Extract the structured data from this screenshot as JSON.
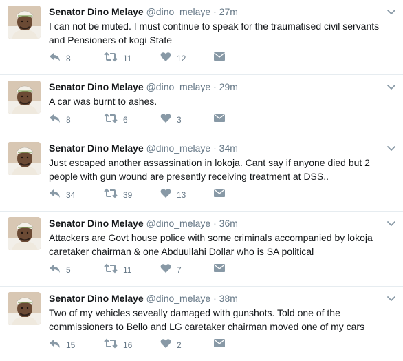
{
  "colors": {
    "icon": "#8899a6",
    "name": "#14171a",
    "meta": "#657786",
    "divider": "#e6ecf0"
  },
  "tweets": [
    {
      "name": "Senator Dino Melaye",
      "handle": "@dino_melaye",
      "separator": "·",
      "time": "27m",
      "text": "I can not be muted. I must continue to speak for the traumatised civil servants and Pensioners of kogi State",
      "replies": "8",
      "retweets": "11",
      "likes": "12"
    },
    {
      "name": "Senator Dino Melaye",
      "handle": "@dino_melaye",
      "separator": "·",
      "time": "29m",
      "text": "A car was burnt to ashes.",
      "replies": "8",
      "retweets": "6",
      "likes": "3"
    },
    {
      "name": "Senator Dino Melaye",
      "handle": "@dino_melaye",
      "separator": "·",
      "time": "34m",
      "text": "Just escaped another assassination in lokoja. Cant say if anyone died but 2 people with gun wound are presently receiving treatment at DSS..",
      "replies": "34",
      "retweets": "39",
      "likes": "13"
    },
    {
      "name": "Senator Dino Melaye",
      "handle": "@dino_melaye",
      "separator": "·",
      "time": "36m",
      "text": "Attackers are Govt house police with some criminals accompanied by lokoja caretaker chairman & one Abduullahi Dollar who is SA political",
      "replies": "5",
      "retweets": "11",
      "likes": "7"
    },
    {
      "name": "Senator Dino Melaye",
      "handle": "@dino_melaye",
      "separator": "·",
      "time": "38m",
      "text": "Two of my vehicles seveally damaged with gunshots. Told one of the commissioners to Bello and LG caretaker chairman moved one of my cars",
      "replies": "15",
      "retweets": "16",
      "likes": "2"
    }
  ]
}
